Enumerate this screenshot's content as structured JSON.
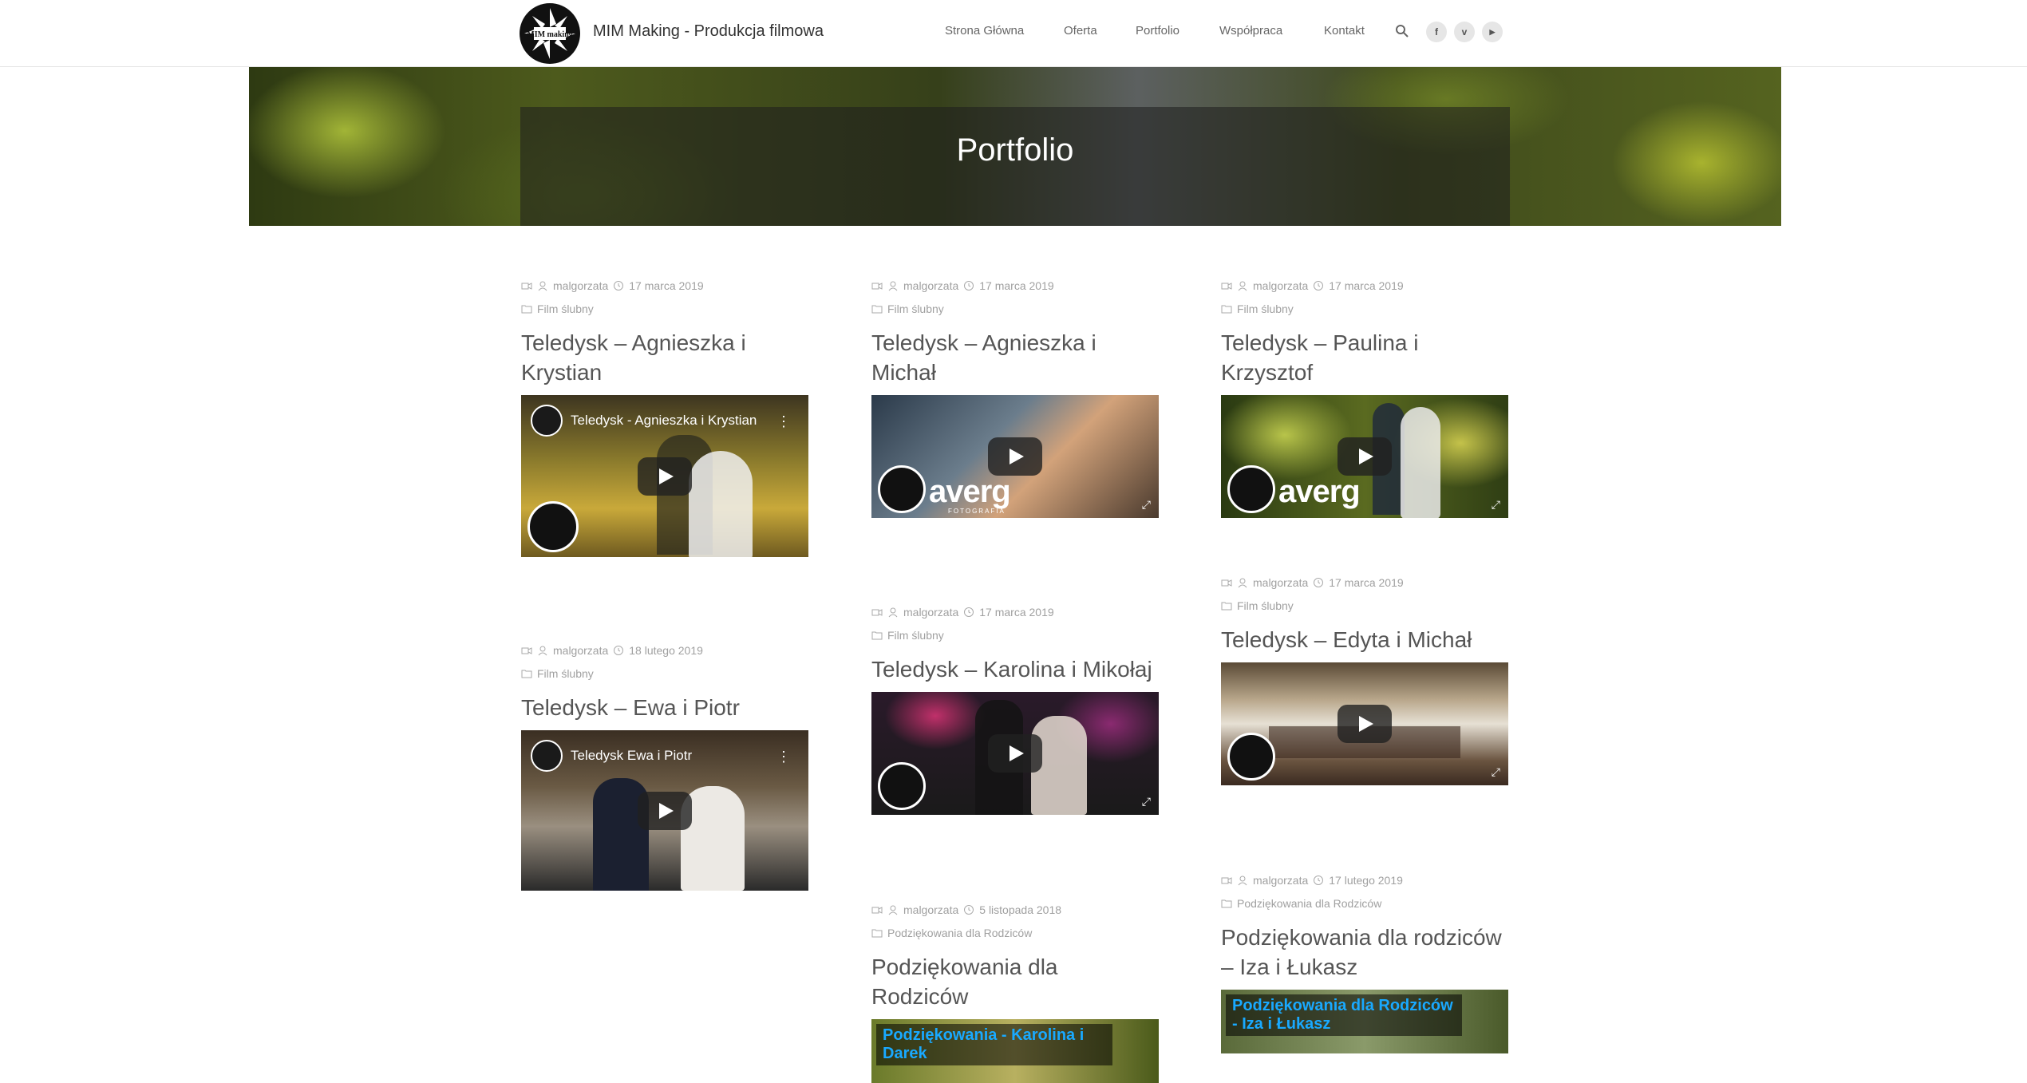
{
  "header": {
    "site_title": "MIM Making - Produkcja filmowa",
    "logo_text": "MIM making",
    "nav": [
      "Strona Główna",
      "Oferta",
      "Portfolio",
      "Współpraca",
      "Kontakt"
    ],
    "social": [
      {
        "icon": "facebook-icon",
        "glyph": "f"
      },
      {
        "icon": "vimeo-icon",
        "glyph": "v"
      },
      {
        "icon": "youtube-icon",
        "glyph": "▶"
      }
    ]
  },
  "banner": {
    "title": "Portfolio"
  },
  "posts": [
    {
      "author": "malgorzata",
      "date": "17 marca 2019",
      "category": "Film ślubny",
      "title": "Teledysk – Agnieszka i Krystian",
      "video_title": "Teledysk - Agnieszka i Krystian"
    },
    {
      "author": "malgorzata",
      "date": "17 marca 2019",
      "category": "Film ślubny",
      "title": "Teledysk – Agnieszka i Michał",
      "watermark": "averg",
      "watermark_sub": "FOTOGRAFIA"
    },
    {
      "author": "malgorzata",
      "date": "17 marca 2019",
      "category": "Film ślubny",
      "title": "Teledysk – Paulina i Krzysztof",
      "watermark": "averg"
    },
    {
      "author": "malgorzata",
      "date": "18 lutego 2019",
      "category": "Film ślubny",
      "title": "Teledysk – Ewa i Piotr",
      "video_title": "Teledysk Ewa i Piotr"
    },
    {
      "author": "malgorzata",
      "date": "17 marca 2019",
      "category": "Film ślubny",
      "title": "Teledysk – Karolina i Mikołaj"
    },
    {
      "author": "malgorzata",
      "date": "17 marca 2019",
      "category": "Film ślubny",
      "title": "Teledysk – Edyta i Michał"
    },
    {
      "author": "malgorzata",
      "date": "5 listopada 2018",
      "category": "Podziękowania dla Rodziców",
      "title": "Podziękowania dla Rodziców",
      "video_title": "Podziękowania - Karolina i Darek"
    },
    {
      "author": "malgorzata",
      "date": "17 lutego 2019",
      "category": "Podziękowania dla Rodziców",
      "title": "Podziękowania dla rodziców – Iza i Łukasz",
      "video_title": "Podziękowania dla Rodziców - Iza i Łukasz"
    }
  ]
}
